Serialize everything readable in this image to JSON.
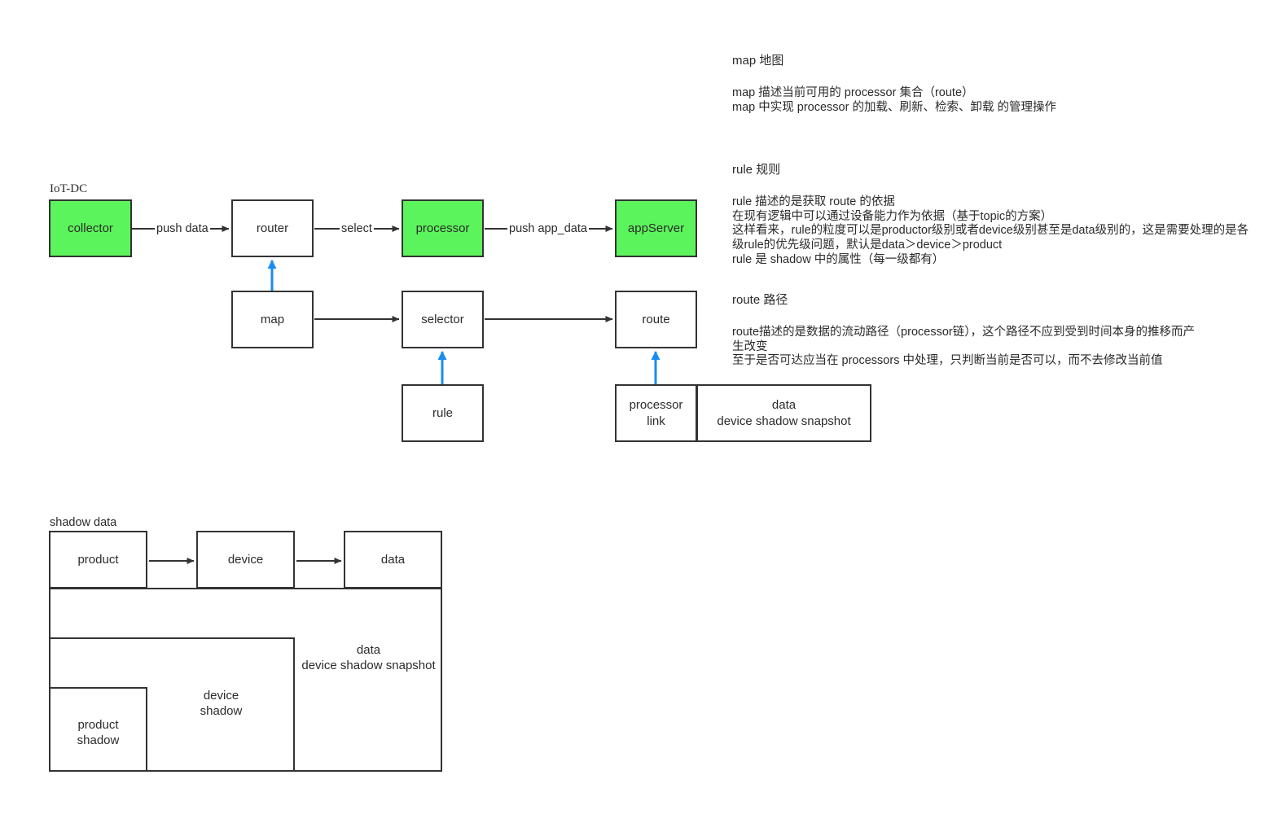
{
  "diagram": {
    "title_labels": {
      "iot_dc": "IoT-DC",
      "shadow_data": "shadow data"
    },
    "pipeline": {
      "nodes": [
        {
          "id": "collector",
          "label": "collector",
          "filled": true
        },
        {
          "id": "router",
          "label": "router",
          "filled": false
        },
        {
          "id": "processor",
          "label": "processor",
          "filled": true
        },
        {
          "id": "appserver",
          "label": "appServer",
          "filled": true
        },
        {
          "id": "map",
          "label": "map",
          "filled": false
        },
        {
          "id": "selector",
          "label": "selector",
          "filled": false
        },
        {
          "id": "route",
          "label": "route",
          "filled": false
        },
        {
          "id": "rule",
          "label": "rule",
          "filled": false
        },
        {
          "id": "processor_link",
          "label": "processor\nlink",
          "filled": false
        },
        {
          "id": "data_snapshot",
          "label": "data\ndevice shadow snapshot",
          "filled": false
        }
      ],
      "edge_labels": {
        "push_data": "push data",
        "select": "select",
        "push_app_data": "push app_data"
      }
    },
    "shadow_data": {
      "row": [
        {
          "id": "product",
          "label": "product"
        },
        {
          "id": "device",
          "label": "device"
        },
        {
          "id": "data",
          "label": "data"
        }
      ],
      "frames": [
        {
          "id": "data-device-shadow-snapshot",
          "label": "data\ndevice shadow snapshot"
        },
        {
          "id": "device-shadow",
          "label": "device\nshadow"
        },
        {
          "id": "product-shadow",
          "label": "product\nshadow"
        }
      ]
    },
    "notes": [
      {
        "id": "map",
        "title": "map 地图",
        "lines": [
          "map 描述当前可用的 processor 集合（route）",
          "map 中实现 processor 的加载、刷新、检索、卸载 的管理操作"
        ]
      },
      {
        "id": "rule",
        "title": "rule 规则",
        "lines": [
          "rule 描述的是获取 route 的依据",
          "在现有逻辑中可以通过设备能力作为依据（基于topic的方案）",
          "这样看来，rule的粒度可以是productor级别或者device级别甚至是data级别的，这是需要处理的是各",
          "级rule的优先级问题，默认是data＞device＞product",
          "rule 是 shadow 中的属性（每一级都有）"
        ]
      },
      {
        "id": "route",
        "title": "route 路径",
        "lines": [
          "route描述的是数据的流动路径（processor链），这个路径不应到受到时间本身的推移而产",
          "生改变",
          "至于是否可达应当在 processors 中处理，只判断当前是否可以，而不去修改当前值"
        ]
      }
    ],
    "colors": {
      "node_fill": "#5cf45c",
      "stroke": "#333333",
      "blue_arrow": "#1a8cf0",
      "text": "#2b2b2b"
    }
  }
}
